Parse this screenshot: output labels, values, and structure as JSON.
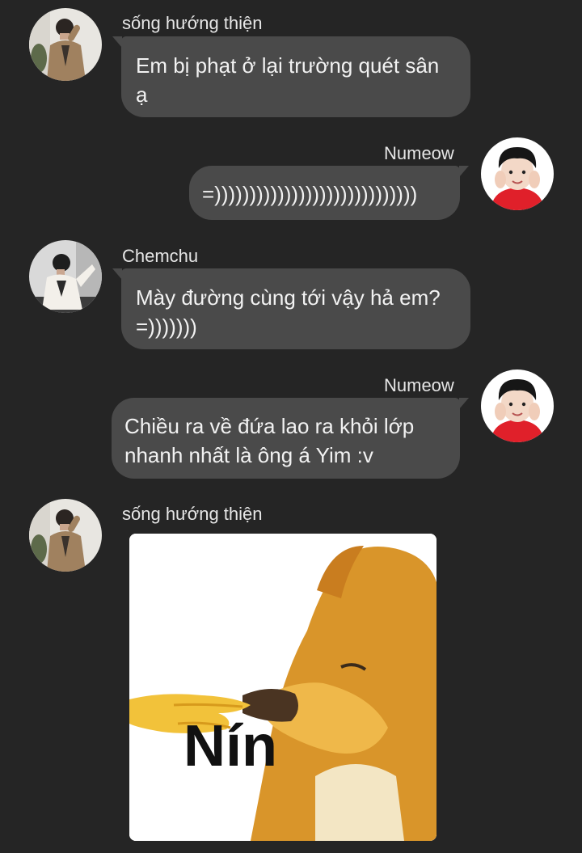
{
  "messages": [
    {
      "sender": "sống hướng thiện",
      "lines": [
        "Em bị phạt ở lại trường quét sân",
        "ạ"
      ]
    },
    {
      "sender": "Numeow",
      "lines": [
        "=)))))))))))))))))))))))))))))"
      ]
    },
    {
      "sender": "Chemchu",
      "lines": [
        "Mày đường cùng tới vậy hả em?",
        "=)))))))"
      ]
    },
    {
      "sender": "Numeow",
      "lines": [
        "Chiều ra về đứa lao ra khỏi lớp",
        "nhanh nhất là ông á Yim :v"
      ]
    },
    {
      "sender": "sống hướng thiện",
      "sticker_caption": "Nín"
    }
  ],
  "colors": {
    "background": "#252525",
    "bubble": "#4a4a4a",
    "text": "#f2f2f2"
  }
}
